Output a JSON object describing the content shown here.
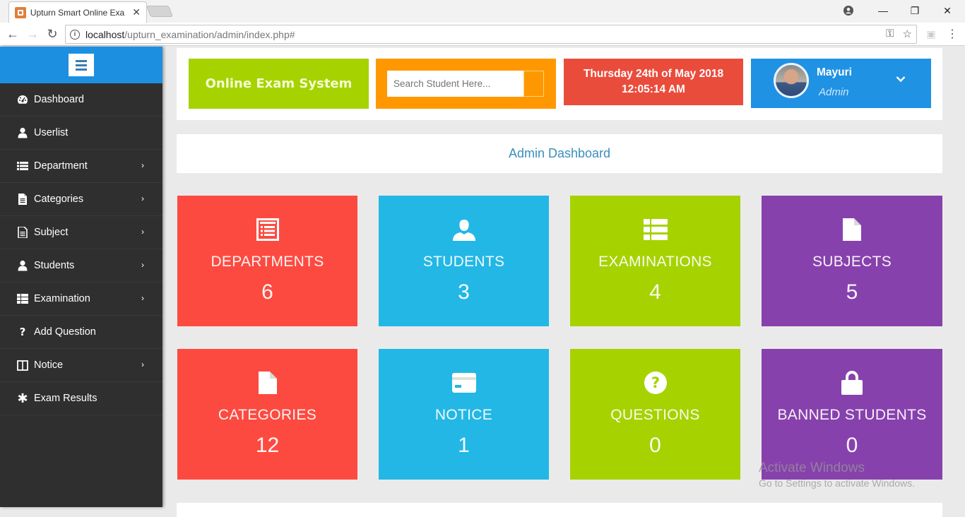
{
  "browser": {
    "tab_title": "Upturn Smart Online Exa",
    "url_host": "localhost",
    "url_path": "/upturn_examination/admin/index.php#"
  },
  "sidebar": {
    "items": [
      {
        "label": "Dashboard",
        "icon": "dashboard-icon",
        "has_submenu": false
      },
      {
        "label": "Userlist",
        "icon": "user-icon",
        "has_submenu": false
      },
      {
        "label": "Department",
        "icon": "list-icon",
        "has_submenu": true
      },
      {
        "label": "Categories",
        "icon": "file-text-icon",
        "has_submenu": true
      },
      {
        "label": "Subject",
        "icon": "file-alt-icon",
        "has_submenu": true
      },
      {
        "label": "Students",
        "icon": "user-icon",
        "has_submenu": true
      },
      {
        "label": "Examination",
        "icon": "table-icon",
        "has_submenu": true
      },
      {
        "label": "Add Question",
        "icon": "question-icon",
        "has_submenu": false
      },
      {
        "label": "Notice",
        "icon": "columns-icon",
        "has_submenu": true
      },
      {
        "label": "Exam Results",
        "icon": "asterisk-icon",
        "has_submenu": false
      }
    ]
  },
  "header": {
    "brand": "Online Exam System",
    "search_placeholder": "Search Student Here...",
    "date": "Thursday 24th of May 2018",
    "time": "12:05:14 AM",
    "user_name": "Mayuri",
    "user_role": "Admin"
  },
  "page_title": "Admin Dashboard",
  "tiles": [
    {
      "label": "DEPARTMENTS",
      "count": "6",
      "icon": "list-alt-icon",
      "color": "#fd4a40"
    },
    {
      "label": "STUDENTS",
      "count": "3",
      "icon": "user-icon",
      "color": "#23b7e5"
    },
    {
      "label": "EXAMINATIONS",
      "count": "4",
      "icon": "th-list-icon",
      "color": "#a6d200"
    },
    {
      "label": "SUBJECTS",
      "count": "5",
      "icon": "file-icon",
      "color": "#8741ad"
    },
    {
      "label": "CATEGORIES",
      "count": "12",
      "icon": "file-icon",
      "color": "#fd4a40"
    },
    {
      "label": "NOTICE",
      "count": "1",
      "icon": "credit-card-icon",
      "color": "#23b7e5"
    },
    {
      "label": "QUESTIONS",
      "count": "0",
      "icon": "question-circle-icon",
      "color": "#a6d200"
    },
    {
      "label": "BANNED STUDENTS",
      "count": "0",
      "icon": "lock-icon",
      "color": "#8741ad"
    }
  ],
  "watermark": {
    "line1": "Activate Windows",
    "line2": "Go to Settings to activate Windows."
  }
}
